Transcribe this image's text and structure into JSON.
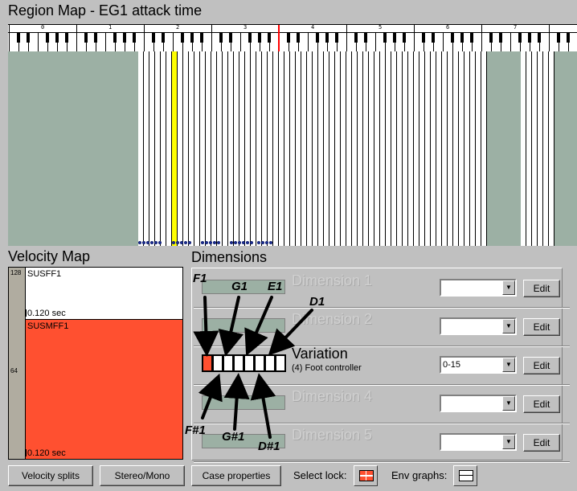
{
  "region_map": {
    "title": "Region Map - EG1 attack time",
    "octave_labels": [
      "0",
      "1",
      "2",
      "3",
      "4",
      "5",
      "6",
      "7"
    ]
  },
  "velocity_map": {
    "title": "Velocity Map",
    "ruler_top": "128",
    "ruler_mid": "64",
    "upper_region": {
      "name": "SUSFF1",
      "time": "0.120 sec"
    },
    "lower_region": {
      "name": "SUSMFF1",
      "time": "0.120 sec"
    },
    "colors": {
      "upper": "#ffffff",
      "lower": "#ff5030"
    }
  },
  "dimensions": {
    "title": "Dimensions",
    "rows": [
      {
        "label": "Dimension 1",
        "value": "",
        "edit": "Edit",
        "active": false
      },
      {
        "label": "Dimension 2",
        "value": "",
        "edit": "Edit",
        "active": false
      },
      {
        "label": "Variation",
        "sub": "(4) Foot controller",
        "value": "0-15",
        "edit": "Edit",
        "active": true
      },
      {
        "label": "Dimension 4",
        "value": "",
        "edit": "Edit",
        "active": false
      },
      {
        "label": "Dimension 5",
        "value": "",
        "edit": "Edit",
        "active": false
      }
    ]
  },
  "annotations": {
    "top": [
      "F1",
      "G1",
      "E1",
      "D1"
    ],
    "bottom": [
      "F#1",
      "G#1",
      "D#1"
    ]
  },
  "toolbar": {
    "velocity_splits": "Velocity splits",
    "stereo_mono": "Stereo/Mono",
    "case_properties": "Case properties",
    "select_lock": "Select lock:",
    "env_graphs": "Env graphs:"
  },
  "colors": {
    "background": "#c0c0c0",
    "region_empty": "#9cb0a4",
    "region_selected": "#ffff00",
    "marker": "#ff0000",
    "selected_variation": "#ff5030"
  }
}
